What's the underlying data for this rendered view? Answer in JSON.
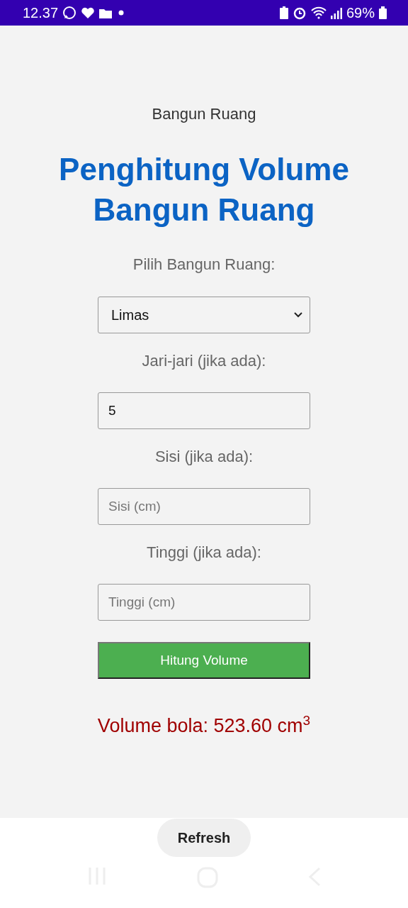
{
  "status_bar": {
    "time": "12.37",
    "battery": "69%"
  },
  "page_title": "Bangun Ruang",
  "heading": [
    "Penghitung Volume",
    "Bangun Ruang"
  ],
  "fields": [
    {
      "kind": "select",
      "label": "Pilih Bangun Ruang:",
      "value": "Limas"
    },
    {
      "kind": "input",
      "label": "Jari-jari (jika ada):",
      "value": "5"
    },
    {
      "kind": "input",
      "label": "Sisi (jika ada):",
      "placeholder": "Sisi (cm)"
    },
    {
      "kind": "input",
      "label": "Tinggi (jika ada):",
      "placeholder": "Tinggi (cm)"
    }
  ],
  "submit_button": "Hitung Volume",
  "result": "Volume bola: 523.60 cm$^{3}$",
  "refresh_button": "Refresh"
}
